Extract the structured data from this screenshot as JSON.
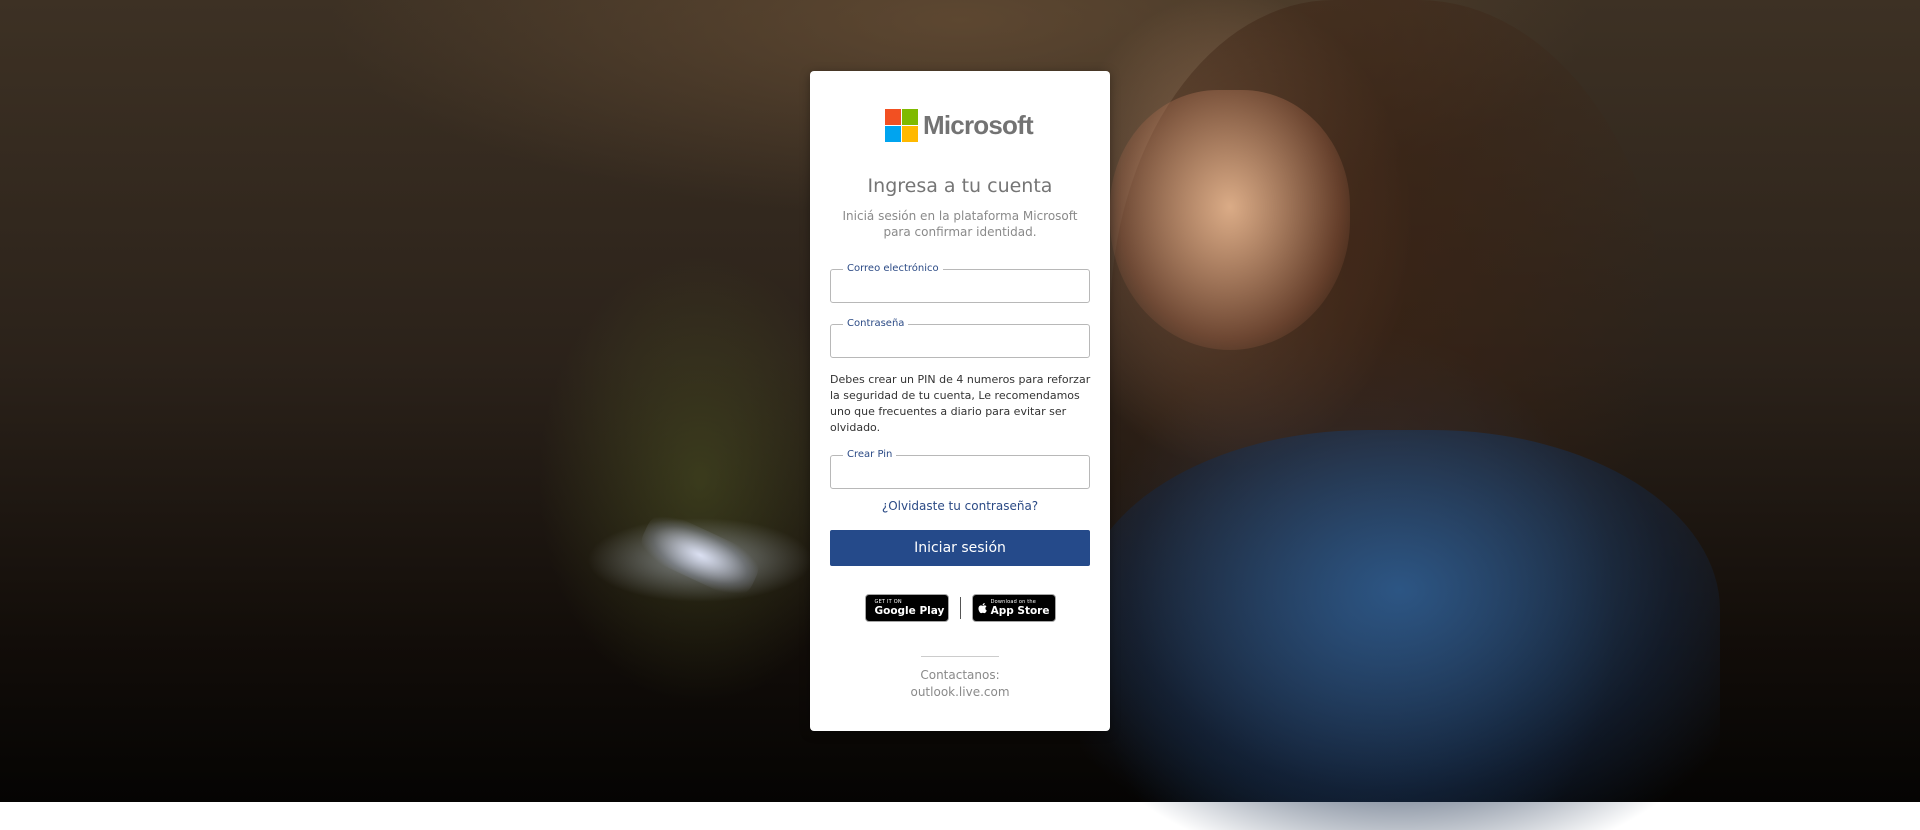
{
  "brand": {
    "name": "Microsoft",
    "colors": {
      "red": "#f25022",
      "green": "#7fba00",
      "blue": "#00a4ef",
      "yellow": "#ffb900"
    }
  },
  "login": {
    "title": "Ingresa a tu cuenta",
    "subtitle": "Iniciá sesión en la plataforma Microsoft para confirmar identidad.",
    "email": {
      "label": "Correo electrónico",
      "value": ""
    },
    "password": {
      "label": "Contraseña",
      "value": ""
    },
    "notice": "Debes crear un PIN de 4 numeros para reforzar la seguridad de tu cuenta, Le recomendamos uno que frecuentes a diario para evitar ser olvidado.",
    "pin": {
      "label": "Crear Pin",
      "value": ""
    },
    "forgot_link": "¿Olvidaste tu contraseña?",
    "submit_label": "Iniciar sesión",
    "accent_color": "#254a8a"
  },
  "stores": {
    "google_play": {
      "small": "GET IT ON",
      "big": "Google Play",
      "icon": "google-play-icon"
    },
    "app_store": {
      "small": "Download on the",
      "big": "App Store",
      "icon": "apple-icon"
    }
  },
  "contact": {
    "label": "Contactanos:",
    "value": "outlook.live.com"
  }
}
